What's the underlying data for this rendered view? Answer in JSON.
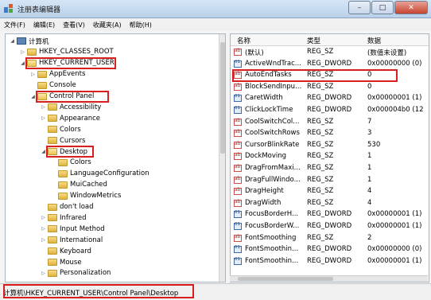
{
  "window": {
    "title": "注册表编辑器",
    "close_label": "✕",
    "min_label": "–",
    "max_label": "□"
  },
  "menu": [
    "文件(F)",
    "编辑(E)",
    "查看(V)",
    "收藏夹(A)",
    "帮助(H)"
  ],
  "tree": [
    {
      "label": "计算机",
      "level": 0,
      "expander": "◢",
      "kind": "pc"
    },
    {
      "label": "HKEY_CLASSES_ROOT",
      "level": 1,
      "expander": "▷",
      "kind": "folder"
    },
    {
      "label": "HKEY_CURRENT_USER",
      "level": 1,
      "expander": "◢",
      "kind": "open",
      "hl": true
    },
    {
      "label": "AppEvents",
      "level": 2,
      "expander": "▷",
      "kind": "folder"
    },
    {
      "label": "Console",
      "level": 2,
      "expander": "",
      "kind": "folder"
    },
    {
      "label": "Control Panel",
      "level": 2,
      "expander": "◢",
      "kind": "open",
      "hl": true
    },
    {
      "label": "Accessibility",
      "level": 3,
      "expander": "▷",
      "kind": "folder"
    },
    {
      "label": "Appearance",
      "level": 3,
      "expander": "▷",
      "kind": "folder"
    },
    {
      "label": "Colors",
      "level": 3,
      "expander": "",
      "kind": "folder"
    },
    {
      "label": "Cursors",
      "level": 3,
      "expander": "",
      "kind": "folder"
    },
    {
      "label": "Desktop",
      "level": 3,
      "expander": "◢",
      "kind": "open",
      "hl": true
    },
    {
      "label": "Colors",
      "level": 4,
      "expander": "",
      "kind": "folder"
    },
    {
      "label": "LanguageConfiguration",
      "level": 4,
      "expander": "",
      "kind": "folder"
    },
    {
      "label": "MuiCached",
      "level": 4,
      "expander": "",
      "kind": "folder"
    },
    {
      "label": "WindowMetrics",
      "level": 4,
      "expander": "",
      "kind": "folder"
    },
    {
      "label": "don't load",
      "level": 3,
      "expander": "",
      "kind": "folder"
    },
    {
      "label": "Infrared",
      "level": 3,
      "expander": "▷",
      "kind": "folder"
    },
    {
      "label": "Input Method",
      "level": 3,
      "expander": "▷",
      "kind": "folder"
    },
    {
      "label": "International",
      "level": 3,
      "expander": "▷",
      "kind": "folder"
    },
    {
      "label": "Keyboard",
      "level": 3,
      "expander": "",
      "kind": "folder"
    },
    {
      "label": "Mouse",
      "level": 3,
      "expander": "",
      "kind": "folder"
    },
    {
      "label": "Personalization",
      "level": 3,
      "expander": "▷",
      "kind": "folder"
    }
  ],
  "values_header": {
    "name": "名称",
    "type": "类型",
    "data": "数据"
  },
  "values": [
    {
      "name": "(默认)",
      "type": "REG_SZ",
      "data": "(数值未设置)",
      "icon": "sz"
    },
    {
      "name": "ActiveWndTrac...",
      "type": "REG_DWORD",
      "data": "0x00000000 (0)",
      "icon": "dw"
    },
    {
      "name": "AutoEndTasks",
      "type": "REG_SZ",
      "data": "0",
      "icon": "sz",
      "hl": true
    },
    {
      "name": "BlockSendInpu...",
      "type": "REG_SZ",
      "data": "0",
      "icon": "sz"
    },
    {
      "name": "CaretWidth",
      "type": "REG_DWORD",
      "data": "0x00000001 (1)",
      "icon": "dw"
    },
    {
      "name": "ClickLockTime",
      "type": "REG_DWORD",
      "data": "0x000004b0 (12",
      "icon": "dw"
    },
    {
      "name": "CoolSwitchCol...",
      "type": "REG_SZ",
      "data": "7",
      "icon": "sz"
    },
    {
      "name": "CoolSwitchRows",
      "type": "REG_SZ",
      "data": "3",
      "icon": "sz"
    },
    {
      "name": "CursorBlinkRate",
      "type": "REG_SZ",
      "data": "530",
      "icon": "sz"
    },
    {
      "name": "DockMoving",
      "type": "REG_SZ",
      "data": "1",
      "icon": "sz"
    },
    {
      "name": "DragFromMaxi...",
      "type": "REG_SZ",
      "data": "1",
      "icon": "sz"
    },
    {
      "name": "DragFullWindo...",
      "type": "REG_SZ",
      "data": "1",
      "icon": "sz"
    },
    {
      "name": "DragHeight",
      "type": "REG_SZ",
      "data": "4",
      "icon": "sz"
    },
    {
      "name": "DragWidth",
      "type": "REG_SZ",
      "data": "4",
      "icon": "sz"
    },
    {
      "name": "FocusBorderH...",
      "type": "REG_DWORD",
      "data": "0x00000001 (1)",
      "icon": "dw"
    },
    {
      "name": "FocusBorderW...",
      "type": "REG_DWORD",
      "data": "0x00000001 (1)",
      "icon": "dw"
    },
    {
      "name": "FontSmoothing",
      "type": "REG_SZ",
      "data": "2",
      "icon": "sz"
    },
    {
      "name": "FontSmoothin...",
      "type": "REG_DWORD",
      "data": "0x00000000 (0)",
      "icon": "dw"
    },
    {
      "name": "FontSmoothin...",
      "type": "REG_DWORD",
      "data": "0x00000001 (1)",
      "icon": "dw"
    }
  ],
  "status": "计算机\\HKEY_CURRENT_USER\\Control Panel\\Desktop",
  "colors": {
    "highlight": "#d81e1e"
  }
}
